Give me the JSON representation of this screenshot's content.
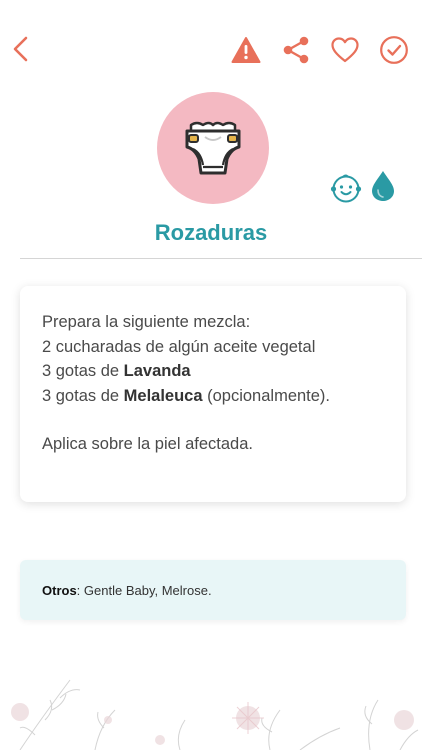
{
  "header": {
    "back_icon": "chevron-left-icon",
    "actions": [
      "warning-icon",
      "share-icon",
      "heart-icon",
      "check-circle-icon"
    ],
    "accent_color": "#e8705a"
  },
  "hero": {
    "icon": "diaper-icon",
    "circle_color": "#f4b9c2",
    "tags": [
      "baby-face-icon",
      "drop-icon"
    ],
    "tag_color": "#2a9aa4"
  },
  "title": "Rozaduras",
  "instructions": {
    "line1": "Prepara la siguiente mezcla:",
    "line2": "2 cucharadas de algún aceite vegetal",
    "line3_prefix": "3 gotas de ",
    "line3_bold": "Lavanda",
    "line4_prefix": "3 gotas de ",
    "line4_bold": "Melaleuca",
    "line4_suffix": " (opcionalmente).",
    "line5": "Aplica sobre la piel afectada."
  },
  "otros": {
    "label": "Otros",
    "separator": ": ",
    "value": "Gentle Baby, Melrose."
  }
}
